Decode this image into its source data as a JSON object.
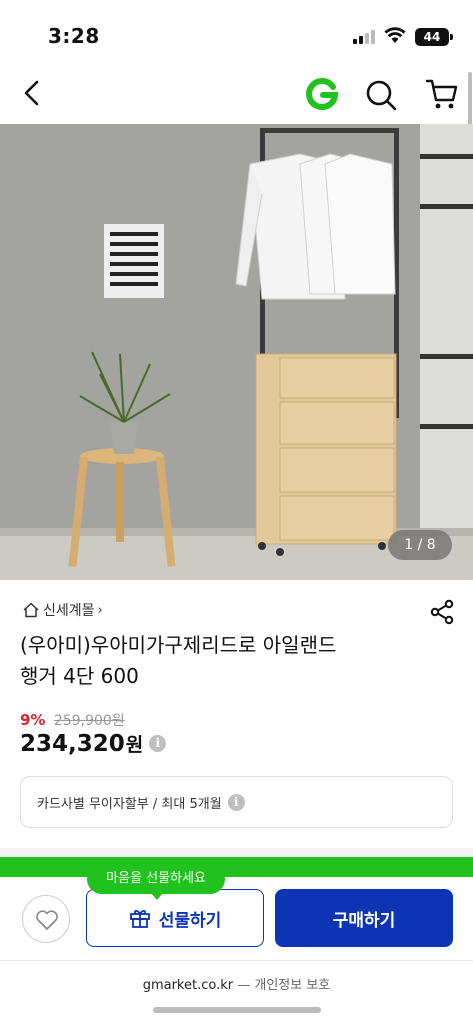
{
  "status_bar": {
    "time": "3:28",
    "battery": "44"
  },
  "nav": {
    "logo_letter": "G"
  },
  "gallery": {
    "counter": "1 / 8"
  },
  "breadcrumb": {
    "label": "신세계몰"
  },
  "product": {
    "title_line1": "(우아미)우아미가구제리드로 아일랜드",
    "title_line2": "행거 4단 600",
    "discount": "9%",
    "original_price": "259,900원",
    "price": "234,320",
    "price_unit": "원",
    "installment": "카드사별 무이자할부 / 최대 5개월"
  },
  "actions": {
    "gift_tooltip": "마음을 선물하세요",
    "gift_label": "선물하기",
    "buy_label": "구매하기"
  },
  "footer": {
    "domain": "gmarket.co.kr",
    "separator": " — ",
    "privacy": "개인정보 보호"
  },
  "colors": {
    "brand_green": "#21c11e",
    "primary_blue": "#0c34b5",
    "discount_red": "#e0222e"
  }
}
